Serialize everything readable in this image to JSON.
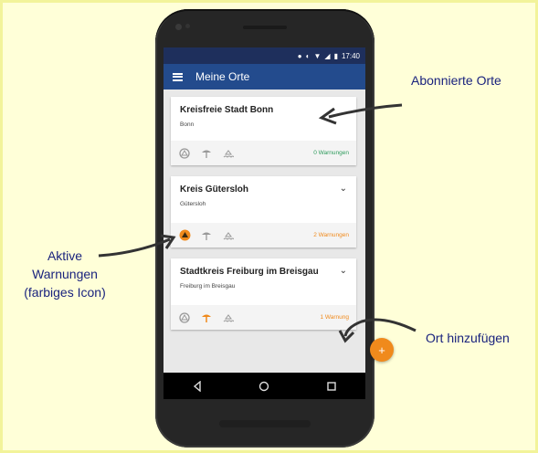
{
  "statusbar": {
    "time": "17:40"
  },
  "appbar": {
    "title": "Meine Orte"
  },
  "places": [
    {
      "title": "Kreisfreie Stadt Bonn",
      "subtitle": "Bonn",
      "warnings": "0 Warnungen",
      "warning_color": "#2e9b5c",
      "has_chevron": false,
      "active_icon": "none"
    },
    {
      "title": "Kreis Gütersloh",
      "subtitle": "Gütersloh",
      "warnings": "2 Warnungen",
      "warning_color": "#f08a1c",
      "has_chevron": true,
      "active_icon": "alert-icon"
    },
    {
      "title": "Stadtkreis Freiburg im Breisgau",
      "subtitle": "Freiburg im Breisgau",
      "warnings": "1 Warnung",
      "warning_color": "#f08a1c",
      "has_chevron": true,
      "active_icon": "weather-icon"
    }
  ],
  "icons": [
    "alert-icon",
    "weather-icon",
    "flood-icon"
  ],
  "fab": {
    "label": "+"
  },
  "annotations": {
    "subscribed": "Abonnierte Orte",
    "active_line1": "Aktive",
    "active_line2": "Warnungen",
    "active_line3": "(farbiges Icon)",
    "add_place": "Ort hinzufügen"
  },
  "colors": {
    "appbar": "#234b8d",
    "statusbar": "#1e2f5c",
    "accent": "#f08a1c",
    "ok": "#2e9b5c",
    "annotation": "#1a237e"
  }
}
